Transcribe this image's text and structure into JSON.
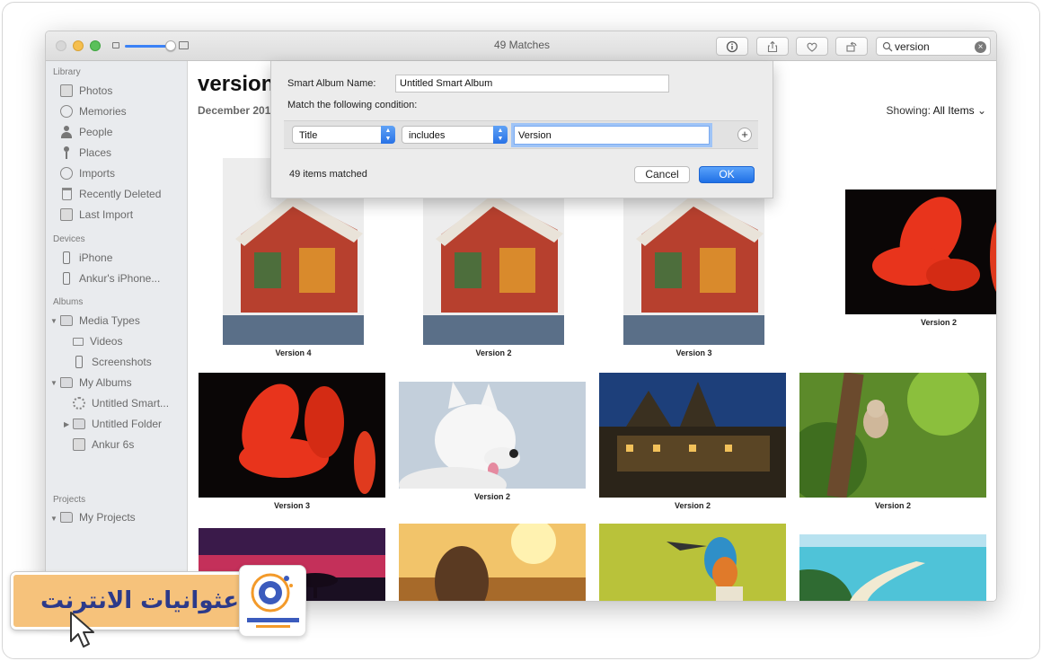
{
  "window": {
    "title": "49 Matches",
    "search_value": "version"
  },
  "toolbar": {
    "info_icon": "info-icon",
    "share_icon": "share-icon",
    "favorite_icon": "heart-icon",
    "rotate_icon": "rotate-icon"
  },
  "sidebar": {
    "library_header": "Library",
    "library_items": [
      "Photos",
      "Memories",
      "People",
      "Places",
      "Imports",
      "Recently Deleted",
      "Last Import"
    ],
    "devices_header": "Devices",
    "device_items": [
      "iPhone",
      "Ankur's iPhone..."
    ],
    "albums_header": "Albums",
    "media_types": "Media Types",
    "videos": "Videos",
    "screenshots": "Screenshots",
    "my_albums": "My Albums",
    "untitled_smart": "Untitled Smart...",
    "untitled_folder": "Untitled Folder",
    "ankur6s": "Ankur 6s",
    "projects_header": "Projects",
    "my_projects": "My Projects"
  },
  "main": {
    "title": "version",
    "date": "December 201",
    "showing_label": "Showing:",
    "showing_value": "All Items",
    "captions": [
      "Version 4",
      "Version 2",
      "Version 3",
      "Version 2",
      "Version 3",
      "Version 2",
      "Version 2",
      "Version 2"
    ]
  },
  "dialog": {
    "name_label": "Smart Album Name:",
    "name_value": "Untitled Smart Album",
    "condition_label": "Match the following condition:",
    "field_value": "Title",
    "operator_value": "includes",
    "text_value": "Version",
    "matched_text": "49 items matched",
    "cancel_label": "Cancel",
    "ok_label": "OK"
  },
  "watermark": {
    "text": "عثوانيات الانترنت",
    "logo_text": "عثوانيات الانترنت"
  },
  "colors": {
    "accent": "#1f6fe5",
    "sidebar_bg": "#e9ebee",
    "watermark_bg": "#f6c27b"
  }
}
